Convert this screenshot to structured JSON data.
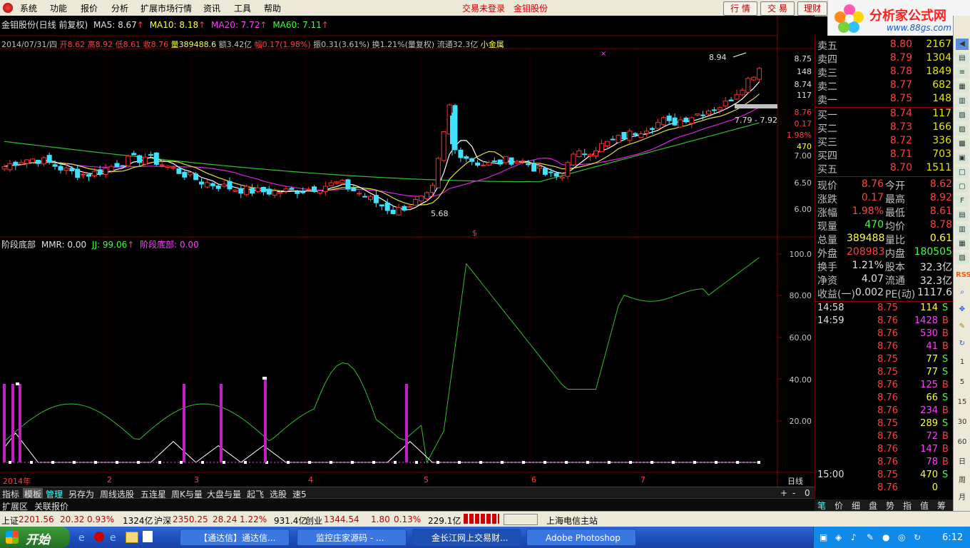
{
  "menu": {
    "items": [
      "系统",
      "功能",
      "报价",
      "分析",
      "扩展市场行情",
      "资讯",
      "工具",
      "帮助"
    ],
    "trade_status": "交易未登录",
    "stock_name": "金钼股份",
    "buttons": [
      "行 情",
      "交 易",
      "理财"
    ]
  },
  "brand": {
    "title": "分析家公式网",
    "url": "www.88gs.com"
  },
  "price_panel": {
    "title": "金钼股份(日线 前复权)",
    "ma5": "MA5: 8.67",
    "ma10": "MA10: 8.18",
    "ma20": "MA20: 7.72",
    "ma60": "MA60: 7.11",
    "date": "2014/07/31/四",
    "open": "开8.62",
    "high": "高8.92",
    "low": "低8.61",
    "close": "收8.76",
    "vol": "量389488.6",
    "amount": "额3.42亿",
    "change": "幅0.17(1.98%)",
    "amp": "振0.31(3.61%)",
    "turnover": "换1.21%(量复权)",
    "float": "流通32.3亿",
    "sector": "小金属",
    "high_mark": "8.94",
    "low_mark": "5.68",
    "range_label": "7.79 - 7.92",
    "yaxis": [
      "8.75",
      "148",
      "8.74",
      "117",
      "8.76",
      "0.17",
      "1.98%",
      "470",
      "7.00",
      "6.50",
      "6.00"
    ]
  },
  "mmr_panel": {
    "title": "阶段底部",
    "mmr": "MMR: 0.00",
    "jj": "JJ: 99.06",
    "label2": "阶段底部: 0.00",
    "yaxis": [
      "100.0",
      "80.00",
      "60.00",
      "40.00",
      "20.00"
    ]
  },
  "xaxis": {
    "labels": [
      "2014年",
      "2",
      "3",
      "4",
      "5",
      "6",
      "7"
    ],
    "period": "日线"
  },
  "tabs": [
    "指标",
    "模板",
    "管理",
    "另存为",
    "周线选股",
    "五连星",
    "周K与量",
    "大盘与量",
    "起飞",
    "选股",
    "速5"
  ],
  "ext_tabs": [
    "扩展区",
    "关联报价"
  ],
  "orderbook": {
    "asks": [
      {
        "label": "卖五",
        "price": "8.80",
        "vol": "2167"
      },
      {
        "label": "卖四",
        "price": "8.79",
        "vol": "1304"
      },
      {
        "label": "卖三",
        "price": "8.78",
        "vol": "1849"
      },
      {
        "label": "卖二",
        "price": "8.77",
        "vol": "682"
      },
      {
        "label": "卖一",
        "price": "8.75",
        "vol": "148"
      }
    ],
    "bids": [
      {
        "label": "买一",
        "price": "8.74",
        "vol": "117"
      },
      {
        "label": "买二",
        "price": "8.73",
        "vol": "166"
      },
      {
        "label": "买三",
        "price": "8.72",
        "vol": "336"
      },
      {
        "label": "买四",
        "price": "8.71",
        "vol": "703"
      },
      {
        "label": "买五",
        "price": "8.70",
        "vol": "1511"
      }
    ]
  },
  "quote": [
    {
      "l1": "现价",
      "v1": "8.76",
      "l2": "今开",
      "v2": "8.62"
    },
    {
      "l1": "涨跌",
      "v1": "0.17",
      "l2": "最高",
      "v2": "8.92"
    },
    {
      "l1": "涨幅",
      "v1": "1.98%",
      "l2": "最低",
      "v2": "8.61"
    },
    {
      "l1": "现量",
      "v1": "470",
      "l2": "均价",
      "v2": "8.78"
    },
    {
      "l1": "总量",
      "v1": "389488",
      "l2": "量比",
      "v2": "0.61"
    },
    {
      "l1": "外盘",
      "v1": "208983",
      "l2": "内盘",
      "v2": "180505"
    },
    {
      "l1": "换手",
      "v1": "1.21%",
      "l2": "股本",
      "v2": "32.3亿"
    },
    {
      "l1": "净资",
      "v1": "4.07",
      "l2": "流通",
      "v2": "32.3亿"
    },
    {
      "l1": "收益(一)",
      "v1": "0.002",
      "l2": "PE(动)",
      "v2": "1117.6"
    }
  ],
  "ticks": [
    {
      "t": "14:58",
      "p": "8.75",
      "v": "114",
      "s": "S"
    },
    {
      "t": "14:59",
      "p": "8.76",
      "v": "1428",
      "s": "B"
    },
    {
      "t": "",
      "p": "8.76",
      "v": "530",
      "s": "B"
    },
    {
      "t": "",
      "p": "8.76",
      "v": "41",
      "s": "B"
    },
    {
      "t": "",
      "p": "8.75",
      "v": "77",
      "s": "S"
    },
    {
      "t": "",
      "p": "8.75",
      "v": "77",
      "s": "S"
    },
    {
      "t": "",
      "p": "8.76",
      "v": "125",
      "s": "B"
    },
    {
      "t": "",
      "p": "8.76",
      "v": "66",
      "s": "S"
    },
    {
      "t": "",
      "p": "8.76",
      "v": "234",
      "s": "B"
    },
    {
      "t": "",
      "p": "8.75",
      "v": "289",
      "s": "S"
    },
    {
      "t": "",
      "p": "8.76",
      "v": "72",
      "s": "B"
    },
    {
      "t": "",
      "p": "8.76",
      "v": "147",
      "s": "B"
    },
    {
      "t": "",
      "p": "8.76",
      "v": "78",
      "s": "B"
    },
    {
      "t": "15:00",
      "p": "8.75",
      "v": "470",
      "s": "S"
    },
    {
      "t": "",
      "p": "8.76",
      "v": "0",
      "s": ""
    }
  ],
  "rtabs": [
    "笔",
    "价",
    "细",
    "盘",
    "势",
    "指",
    "值",
    "筹"
  ],
  "ticker": {
    "sh_label": "上证",
    "sh_val": "2201.56",
    "sh_chg": "20.32",
    "sh_pct": "0.93%",
    "sh_amt": "1324亿",
    "sz_label": "沪深",
    "sz_val": "2350.25",
    "sz_chg": "28.24",
    "sz_pct": "1.22%",
    "sz_amt": "931.4亿",
    "cy_label": "创业",
    "cy_val": "1344.54",
    "cy_chg": "1.80",
    "cy_pct": "0.13%",
    "cy_amt": "229.1亿",
    "server": "上海电信主站"
  },
  "taskbar": {
    "start": "开始",
    "tasks": [
      "【通达信】通达信...",
      "监控庄家源码 - ...",
      "金长江网上交易财...",
      "Adobe Photoshop"
    ],
    "clock": "6:12"
  },
  "chart_data": {
    "type": "candlestick",
    "series_price_range": [
      5.68,
      8.94
    ],
    "months": [
      "2014年",
      "2",
      "3",
      "4",
      "5",
      "6",
      "7"
    ],
    "mmr_range": [
      0,
      100
    ],
    "jj_last": 99.06
  }
}
